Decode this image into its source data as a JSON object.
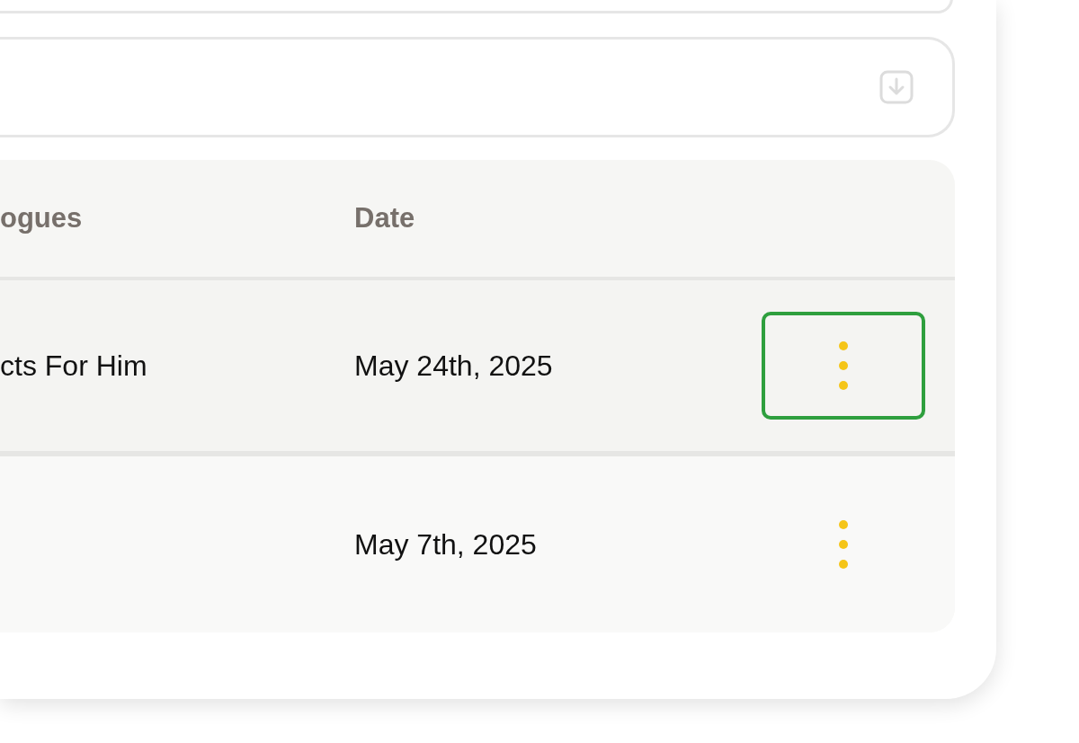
{
  "table": {
    "columns": [
      {
        "label": "ogues"
      },
      {
        "label": "Date"
      }
    ],
    "rows": [
      {
        "column_1": "cts For Him",
        "date": "May 24th, 2025",
        "highlighted": true
      },
      {
        "column_1": "",
        "date": "May 7th, 2025",
        "highlighted": false
      }
    ]
  }
}
